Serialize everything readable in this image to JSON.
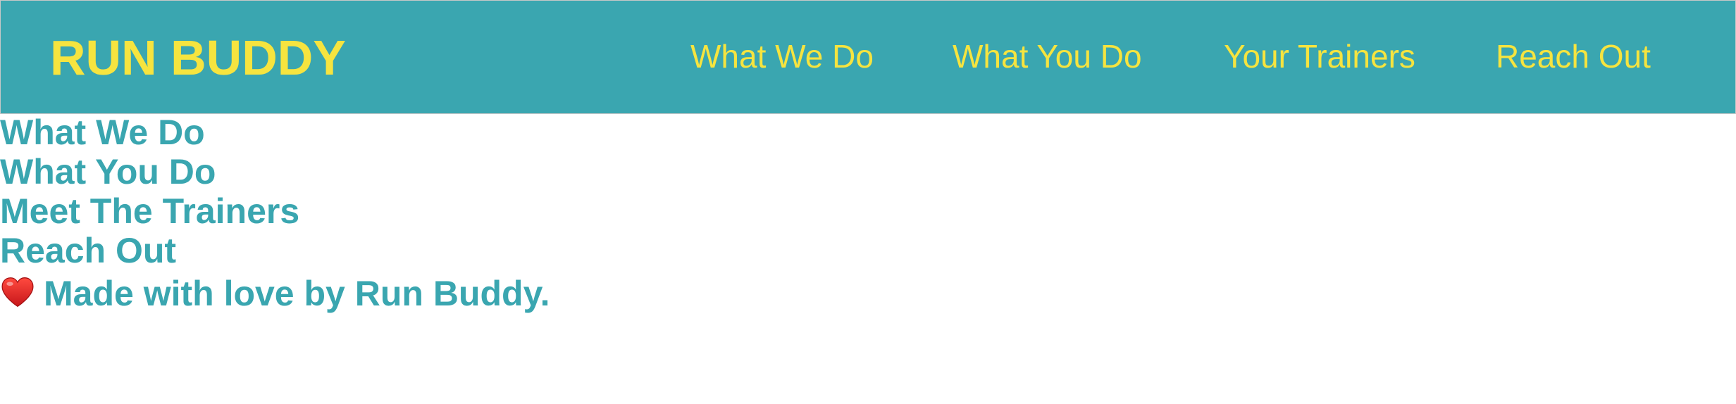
{
  "header": {
    "brand": "RUN BUDDY",
    "nav": [
      {
        "label": "What We Do"
      },
      {
        "label": "What You Do"
      },
      {
        "label": "Your Trainers"
      },
      {
        "label": "Reach Out"
      }
    ]
  },
  "content": {
    "links": [
      {
        "label": "What We Do"
      },
      {
        "label": "What You Do"
      },
      {
        "label": "Meet The Trainers"
      },
      {
        "label": "Reach Out"
      }
    ],
    "footer": {
      "icon": "heart-icon",
      "text": "Made with love by Run Buddy."
    }
  },
  "colors": {
    "header_bg": "#3aa6b0",
    "brand_yellow": "#f6e43f",
    "link_teal": "#3aa6b0",
    "heart_red": "#e0302a"
  }
}
